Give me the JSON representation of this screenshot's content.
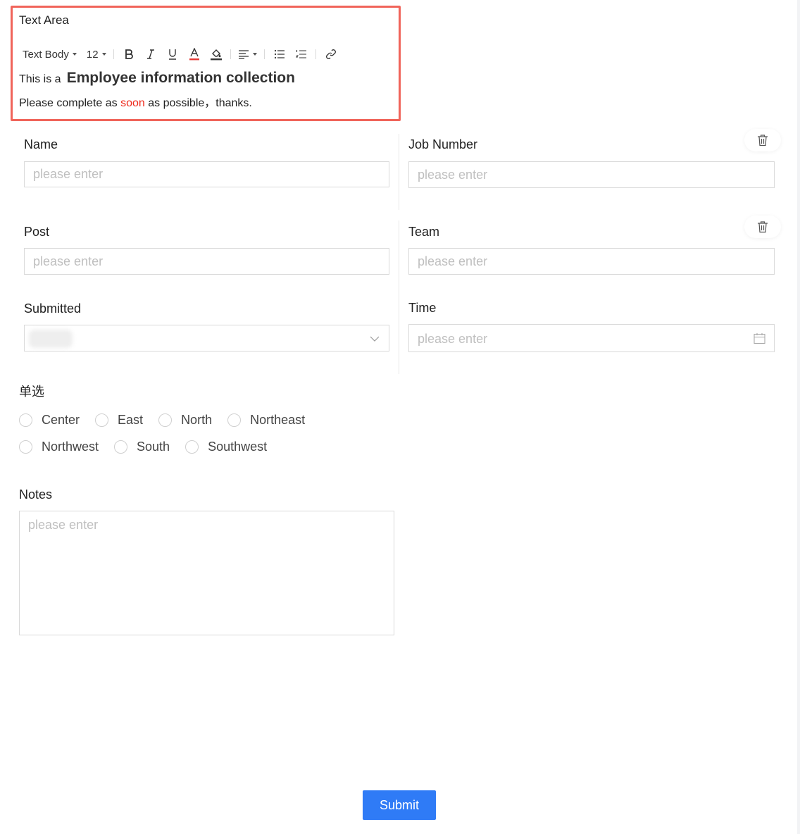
{
  "rich_text": {
    "title": "Text Area",
    "toolbar": {
      "style_label": "Text Body",
      "font_size": "12",
      "buttons": [
        "bold-icon",
        "italic-icon",
        "underline-icon",
        "font-color-icon",
        "highlight-icon",
        "align-icon",
        "bullet-list-icon",
        "numbered-list-icon",
        "link-icon"
      ]
    },
    "line1_prefix": "This is a",
    "line1_heading": "Employee information collection",
    "line2_before": "Please complete as ",
    "line2_highlight": "soon",
    "line2_after": " as possible，thanks."
  },
  "fields": {
    "name": {
      "label": "Name",
      "placeholder": "please enter"
    },
    "job_number": {
      "label": "Job Number",
      "placeholder": "please enter"
    },
    "post": {
      "label": "Post",
      "placeholder": "please enter"
    },
    "team": {
      "label": "Team",
      "placeholder": "please enter"
    },
    "submitted": {
      "label": "Submitted"
    },
    "time": {
      "label": "Time",
      "placeholder": "please enter"
    }
  },
  "radio_group": {
    "label": "单选",
    "options_row1": [
      "Center",
      "East",
      "North",
      "Northeast"
    ],
    "options_row2": [
      "Northwest",
      "South",
      "Southwest"
    ]
  },
  "notes": {
    "label": "Notes",
    "placeholder": "please enter"
  },
  "submit_label": "Submit",
  "colors": {
    "accent": "#2f7bf6",
    "selection_border": "#f0645a",
    "highlight_text": "#ee2a1c",
    "font_color_underline": "#e53935"
  }
}
